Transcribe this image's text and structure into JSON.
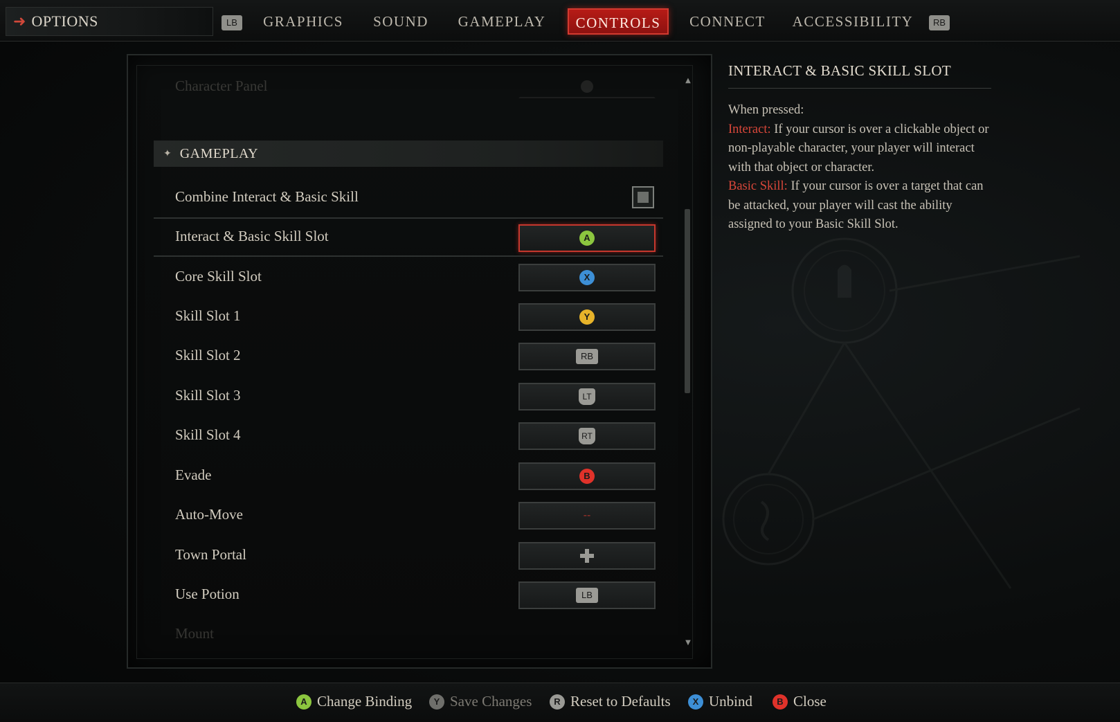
{
  "topbar": {
    "title": "OPTIONS",
    "left_bumper": "LB",
    "right_bumper": "RB",
    "tabs": [
      {
        "label": "GRAPHICS"
      },
      {
        "label": "SOUND"
      },
      {
        "label": "GAMEPLAY"
      },
      {
        "label": "CONTROLS"
      },
      {
        "label": "CONNECT"
      },
      {
        "label": "ACCESSIBILITY"
      }
    ],
    "active_tab": "CONTROLS"
  },
  "settings": {
    "faded_top_row": {
      "label": "Character Panel"
    },
    "section_title": "GAMEPLAY",
    "combine_row": {
      "label": "Combine Interact & Basic Skill",
      "checked": false
    },
    "rows": [
      {
        "label": "Interact & Basic Skill Slot",
        "binding": "A",
        "icon": "a-button-icon",
        "color": "#8cc63f"
      },
      {
        "label": "Core Skill Slot",
        "binding": "X",
        "icon": "x-button-icon",
        "color": "#3d8fd6"
      },
      {
        "label": "Skill Slot 1",
        "binding": "Y",
        "icon": "y-button-icon",
        "color": "#e7b32a"
      },
      {
        "label": "Skill Slot 2",
        "binding": "RB",
        "icon": "rb-bumper-icon",
        "color": "#9a9a95"
      },
      {
        "label": "Skill Slot 3",
        "binding": "LT",
        "icon": "lt-trigger-icon",
        "color": "#9a9a95"
      },
      {
        "label": "Skill Slot 4",
        "binding": "RT",
        "icon": "rt-trigger-icon",
        "color": "#9a9a95"
      },
      {
        "label": "Evade",
        "binding": "B",
        "icon": "b-button-icon",
        "color": "#e0322a"
      },
      {
        "label": "Auto-Move",
        "binding": "--",
        "icon": "unbound-icon",
        "color": "#a4302a"
      },
      {
        "label": "Town Portal",
        "binding": "",
        "icon": "dpad-icon",
        "color": "#9a9a95"
      },
      {
        "label": "Use Potion",
        "binding": "LB",
        "icon": "lb-bumper-icon",
        "color": "#9a9a95"
      }
    ],
    "faded_bottom_row": {
      "label": "Mount"
    },
    "selected_row": "Interact & Basic Skill Slot"
  },
  "description": {
    "title": "INTERACT & BASIC SKILL SLOT",
    "intro": "When pressed:",
    "term1": "Interact:",
    "text1": " If your cursor is over a clickable object or non-playable character, your player will interact with that object or character.",
    "term2": "Basic Skill:",
    "text2": " If your cursor is over a target that can be attacked, your player will cast the ability assigned to your Basic Skill Slot."
  },
  "footer": {
    "hints": [
      {
        "icon_label": "A",
        "label": "Change Binding",
        "color": "#8cc63f",
        "enabled": true
      },
      {
        "icon_label": "Y",
        "label": "Save Changes",
        "color": "#e7b32a",
        "enabled": false
      },
      {
        "icon_label": "R",
        "label": "Reset to Defaults",
        "color": "#9a9a95",
        "enabled": true
      },
      {
        "icon_label": "X",
        "label": "Unbind",
        "color": "#3d8fd6",
        "enabled": true
      },
      {
        "icon_label": "B",
        "label": "Close",
        "color": "#e0322a",
        "enabled": true
      }
    ]
  }
}
